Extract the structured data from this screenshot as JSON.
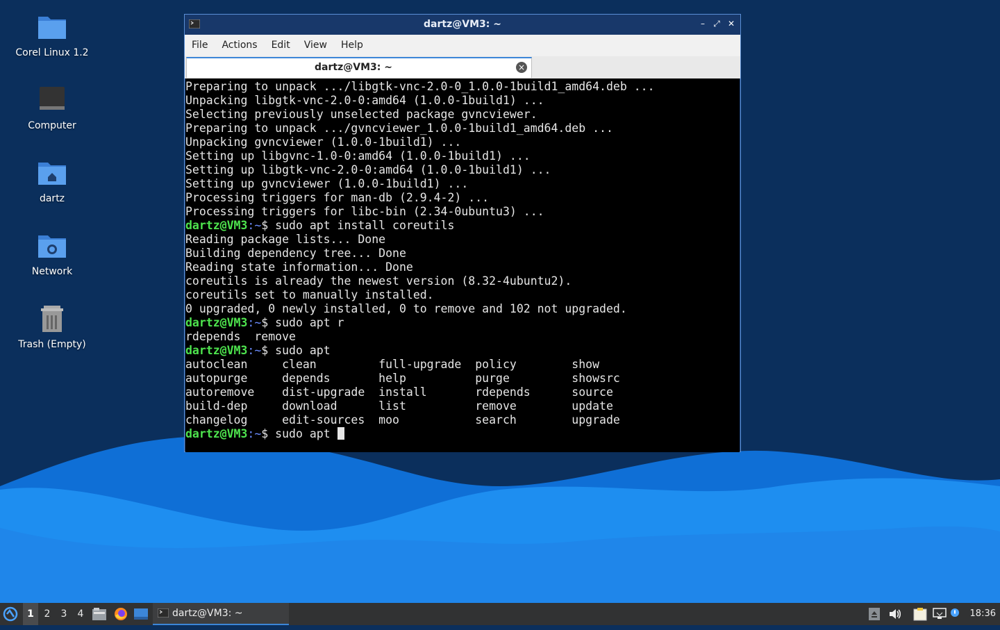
{
  "colors": {
    "wallpaper_dark": "#0b2f5c",
    "wave_light": "#1e8ef0",
    "wave_mid": "#0f6fd6",
    "prompt_user": "#4ee44e",
    "prompt_path": "#6b8cff",
    "accent": "#3c86d8"
  },
  "desktop": {
    "icons": [
      {
        "label": "Corel Linux 1.2",
        "icon": "folder-icon"
      },
      {
        "label": "Computer",
        "icon": "computer-icon"
      },
      {
        "label": "dartz",
        "icon": "home-folder-icon"
      },
      {
        "label": "Network",
        "icon": "network-folder-icon"
      },
      {
        "label": "Trash (Empty)",
        "icon": "trash-icon"
      }
    ]
  },
  "window": {
    "title": "dartz@VM3: ~",
    "menu": [
      "File",
      "Actions",
      "Edit",
      "View",
      "Help"
    ],
    "tab_label": "dartz@VM3: ~",
    "controls": {
      "minimize": "–",
      "maximize": "⤢",
      "close": "✕"
    }
  },
  "terminal": {
    "prompt_user": "dartz@VM3",
    "prompt_path": ":~",
    "prompt_sym": "$ ",
    "lines": [
      {
        "type": "out",
        "text": "Preparing to unpack .../libgtk-vnc-2.0-0_1.0.0-1build1_amd64.deb ..."
      },
      {
        "type": "out",
        "text": "Unpacking libgtk-vnc-2.0-0:amd64 (1.0.0-1build1) ..."
      },
      {
        "type": "out",
        "text": "Selecting previously unselected package gvncviewer."
      },
      {
        "type": "out",
        "text": "Preparing to unpack .../gvncviewer_1.0.0-1build1_amd64.deb ..."
      },
      {
        "type": "out",
        "text": "Unpacking gvncviewer (1.0.0-1build1) ..."
      },
      {
        "type": "out",
        "text": "Setting up libgvnc-1.0-0:amd64 (1.0.0-1build1) ..."
      },
      {
        "type": "out",
        "text": "Setting up libgtk-vnc-2.0-0:amd64 (1.0.0-1build1) ..."
      },
      {
        "type": "out",
        "text": "Setting up gvncviewer (1.0.0-1build1) ..."
      },
      {
        "type": "out",
        "text": "Processing triggers for man-db (2.9.4-2) ..."
      },
      {
        "type": "out",
        "text": "Processing triggers for libc-bin (2.34-0ubuntu3) ..."
      },
      {
        "type": "cmd",
        "text": "sudo apt install coreutils"
      },
      {
        "type": "out",
        "text": "Reading package lists... Done"
      },
      {
        "type": "out",
        "text": "Building dependency tree... Done"
      },
      {
        "type": "out",
        "text": "Reading state information... Done"
      },
      {
        "type": "out",
        "text": "coreutils is already the newest version (8.32-4ubuntu2)."
      },
      {
        "type": "out",
        "text": "coreutils set to manually installed."
      },
      {
        "type": "out",
        "text": "0 upgraded, 0 newly installed, 0 to remove and 102 not upgraded."
      },
      {
        "type": "cmd",
        "text": "sudo apt r"
      },
      {
        "type": "out",
        "text": "rdepends  remove"
      },
      {
        "type": "cmd",
        "text": "sudo apt"
      },
      {
        "type": "out",
        "text": "autoclean     clean         full-upgrade  policy        show"
      },
      {
        "type": "out",
        "text": "autopurge     depends       help          purge         showsrc"
      },
      {
        "type": "out",
        "text": "autoremove    dist-upgrade  install       rdepends      source"
      },
      {
        "type": "out",
        "text": "build-dep     download      list          remove        update"
      },
      {
        "type": "out",
        "text": "changelog     edit-sources  moo           search        upgrade"
      },
      {
        "type": "cmd",
        "text": "sudo apt ",
        "cursor": true
      }
    ]
  },
  "taskbar": {
    "workspaces": [
      "1",
      "2",
      "3",
      "4"
    ],
    "active_workspace": "1",
    "task_label": "dartz@VM3: ~",
    "clock": "18:36",
    "launchers": [
      "file-manager-icon",
      "firefox-icon",
      "desktop-icon"
    ],
    "tray": [
      "eject-icon",
      "volume-icon",
      "clipboard-icon",
      "network-icon",
      "notification-icon"
    ]
  }
}
